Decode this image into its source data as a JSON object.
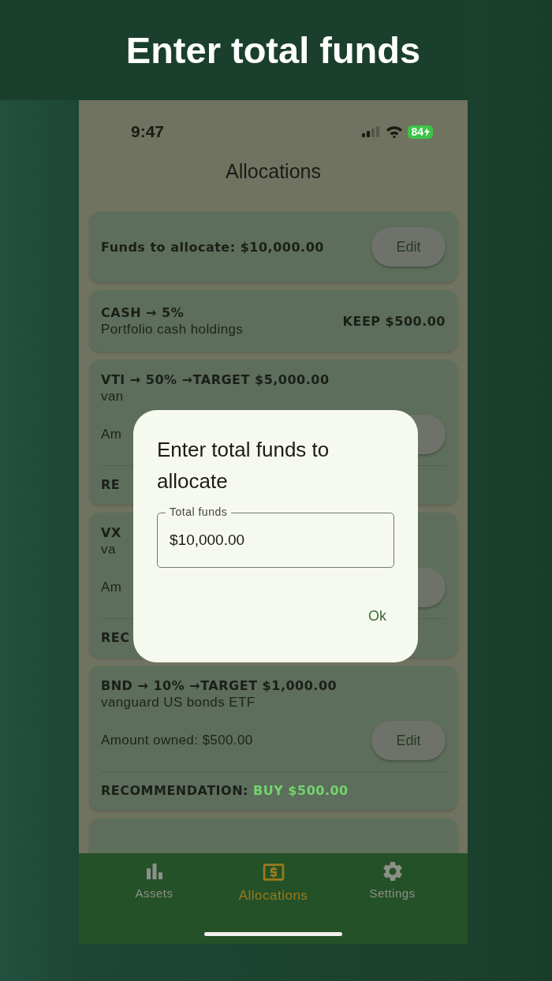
{
  "headline": "Enter total funds",
  "status_bar": {
    "time": "9:47",
    "battery": "84"
  },
  "screen": {
    "title": "Allocations"
  },
  "cards": [
    {
      "kind": "funds",
      "label": "Funds to allocate: $10,000.00",
      "button": "Edit"
    },
    {
      "kind": "cash",
      "title": "CASH → 5%",
      "subtitle": "Portfolio cash holdings",
      "value": "KEEP $500.00"
    },
    {
      "kind": "asset",
      "title": "VTI → 50% →TARGET $5,000.00",
      "subtitle": "van",
      "amount": "Am",
      "recommendation": "RE"
    },
    {
      "kind": "asset",
      "title": "VX",
      "subtitle": "va",
      "amount": "Am",
      "recommendation": "REC"
    },
    {
      "kind": "asset",
      "title": "BND  → 10% →TARGET $1,000.00",
      "subtitle": "vanguard US bonds ETF",
      "amount": "Amount owned: $500.00",
      "button": "Edit",
      "recommendation": "RECOMMENDATION: ",
      "action": "BUY $500.00"
    },
    {
      "kind": "stub"
    }
  ],
  "dialog": {
    "title": "Enter total funds to allocate",
    "field": {
      "label": "Total funds",
      "value": "$10,000.00"
    },
    "button": "Ok"
  },
  "nav": [
    {
      "kind": "chart",
      "label": "Assets",
      "selected": false
    },
    {
      "kind": "money",
      "label": "Allocations",
      "selected": true
    },
    {
      "kind": "gear",
      "label": "Settings",
      "selected": false
    }
  ]
}
